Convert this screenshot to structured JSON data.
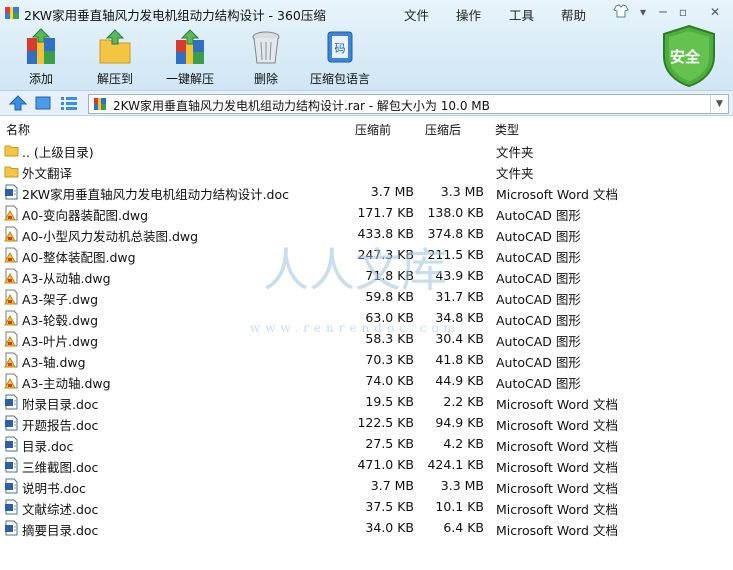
{
  "window": {
    "title": "2KW家用垂直轴风力发电机组动力结构设计 - 360压缩",
    "menu": [
      "文件",
      "操作",
      "工具",
      "帮助"
    ]
  },
  "toolbar": {
    "add": "添加",
    "extract_to": "解压到",
    "one_click_extract": "一键解压",
    "delete": "删除",
    "language": "压缩包语言",
    "safe": "安全"
  },
  "address": {
    "path": "2KW家用垂直轴风力发电机组动力结构设计.rar - 解包大小为 10.0 MB"
  },
  "columns": {
    "name": "名称",
    "before": "压缩前",
    "after": "压缩后",
    "type": "类型"
  },
  "files": [
    {
      "icon": "folder",
      "name": ".. (上级目录)",
      "before": "",
      "after": "",
      "type": "文件夹"
    },
    {
      "icon": "folder",
      "name": "外文翻译",
      "before": "",
      "after": "",
      "type": "文件夹"
    },
    {
      "icon": "doc",
      "name": "2KW家用垂直轴风力发电机组动力结构设计.doc",
      "before": "3.7 MB",
      "after": "3.3 MB",
      "type": "Microsoft Word 文档"
    },
    {
      "icon": "dwg",
      "name": "A0-变向器装配图.dwg",
      "before": "171.7 KB",
      "after": "138.0 KB",
      "type": "AutoCAD 图形"
    },
    {
      "icon": "dwg",
      "name": "A0-小型风力发动机总装图.dwg",
      "before": "433.8 KB",
      "after": "374.8 KB",
      "type": "AutoCAD 图形"
    },
    {
      "icon": "dwg",
      "name": "A0-整体装配图.dwg",
      "before": "247.3 KB",
      "after": "211.5 KB",
      "type": "AutoCAD 图形"
    },
    {
      "icon": "dwg",
      "name": "A3-从动轴.dwg",
      "before": "71.8 KB",
      "after": "43.9 KB",
      "type": "AutoCAD 图形"
    },
    {
      "icon": "dwg",
      "name": "A3-架子.dwg",
      "before": "59.8 KB",
      "after": "31.7 KB",
      "type": "AutoCAD 图形"
    },
    {
      "icon": "dwg",
      "name": "A3-轮毂.dwg",
      "before": "63.0 KB",
      "after": "34.8 KB",
      "type": "AutoCAD 图形"
    },
    {
      "icon": "dwg",
      "name": "A3-叶片.dwg",
      "before": "58.3 KB",
      "after": "30.4 KB",
      "type": "AutoCAD 图形"
    },
    {
      "icon": "dwg",
      "name": "A3-轴.dwg",
      "before": "70.3 KB",
      "after": "41.8 KB",
      "type": "AutoCAD 图形"
    },
    {
      "icon": "dwg",
      "name": "A3-主动轴.dwg",
      "before": "74.0 KB",
      "after": "44.9 KB",
      "type": "AutoCAD 图形"
    },
    {
      "icon": "doc",
      "name": "附录目录.doc",
      "before": "19.5 KB",
      "after": "2.2 KB",
      "type": "Microsoft Word 文档"
    },
    {
      "icon": "doc",
      "name": "开题报告.doc",
      "before": "122.5 KB",
      "after": "94.9 KB",
      "type": "Microsoft Word 文档"
    },
    {
      "icon": "doc",
      "name": "目录.doc",
      "before": "27.5 KB",
      "after": "4.2 KB",
      "type": "Microsoft Word 文档"
    },
    {
      "icon": "doc",
      "name": "三维截图.doc",
      "before": "471.0 KB",
      "after": "424.1 KB",
      "type": "Microsoft Word 文档"
    },
    {
      "icon": "doc",
      "name": "说明书.doc",
      "before": "3.7 MB",
      "after": "3.3 MB",
      "type": "Microsoft Word 文档"
    },
    {
      "icon": "doc",
      "name": "文献综述.doc",
      "before": "37.5 KB",
      "after": "10.1 KB",
      "type": "Microsoft Word 文档"
    },
    {
      "icon": "doc",
      "name": "摘要目录.doc",
      "before": "34.0 KB",
      "after": "6.4 KB",
      "type": "Microsoft Word 文档"
    }
  ],
  "watermark": {
    "text": "人人文库",
    "url": "www.renrendoc.com"
  }
}
